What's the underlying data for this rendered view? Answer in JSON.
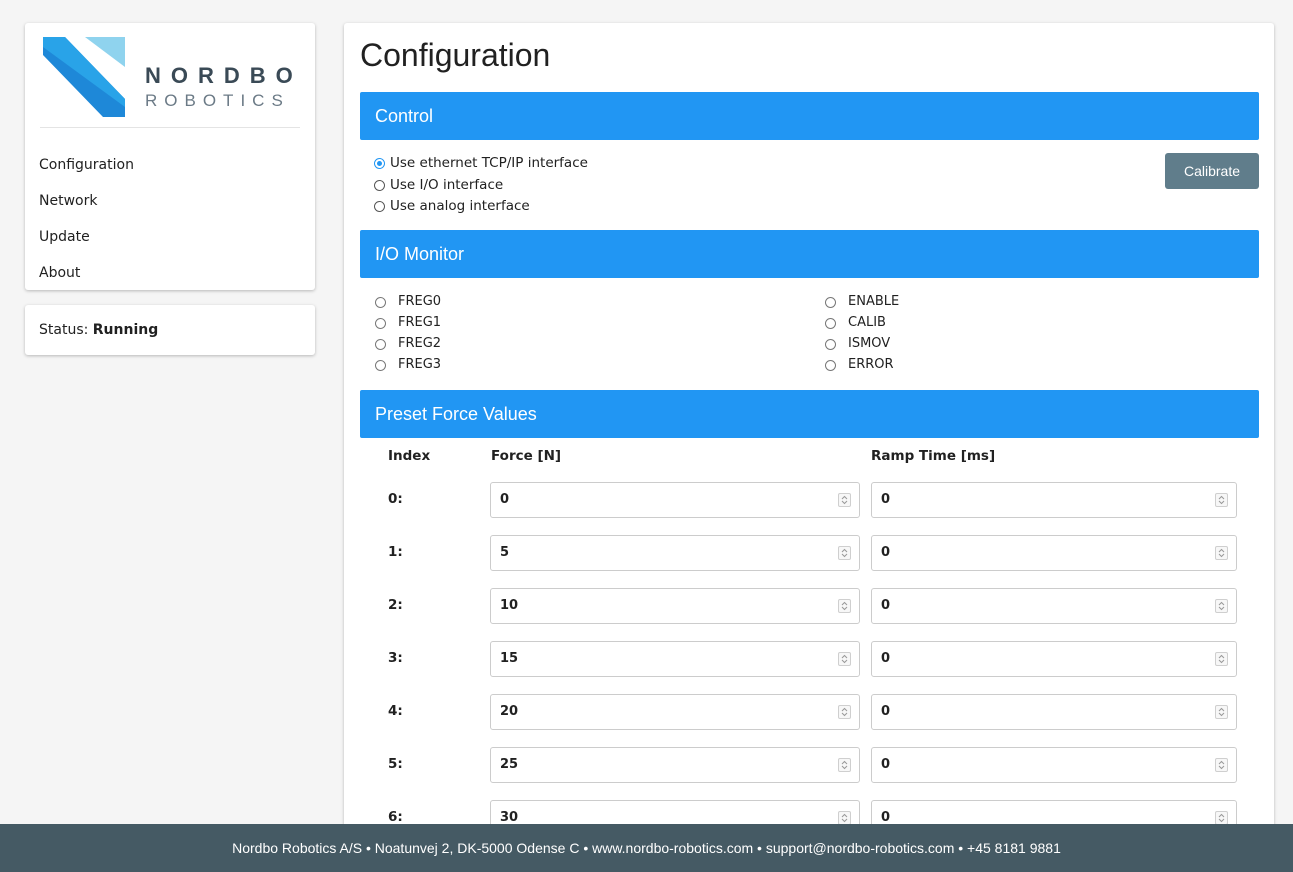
{
  "brand": {
    "name_line1": "NORDBO",
    "name_line2": "ROBOTICS",
    "colors": {
      "primary": "#2196f3",
      "light": "#8fd3ee",
      "footer": "#455a64",
      "button": "#607d8b"
    }
  },
  "sidebar": {
    "items": [
      {
        "label": "Configuration"
      },
      {
        "label": "Network"
      },
      {
        "label": "Update"
      },
      {
        "label": "About"
      }
    ],
    "status": {
      "label": "Status:",
      "value": "Running"
    }
  },
  "main": {
    "title": "Configuration",
    "control": {
      "header": "Control",
      "options": [
        {
          "label": "Use ethernet TCP/IP interface",
          "checked": true
        },
        {
          "label": "Use I/O interface",
          "checked": false
        },
        {
          "label": "Use analog interface",
          "checked": false
        }
      ],
      "calibrate_label": "Calibrate"
    },
    "io_monitor": {
      "header": "I/O Monitor",
      "left": [
        "FREG0",
        "FREG1",
        "FREG2",
        "FREG3"
      ],
      "right": [
        "ENABLE",
        "CALIB",
        "ISMOV",
        "ERROR"
      ]
    },
    "preset": {
      "header": "Preset Force Values",
      "columns": [
        "Index",
        "Force [N]",
        "Ramp Time [ms]"
      ],
      "rows": [
        {
          "index": "0:",
          "force": "0",
          "ramp": "0"
        },
        {
          "index": "1:",
          "force": "5",
          "ramp": "0"
        },
        {
          "index": "2:",
          "force": "10",
          "ramp": "0"
        },
        {
          "index": "3:",
          "force": "15",
          "ramp": "0"
        },
        {
          "index": "4:",
          "force": "20",
          "ramp": "0"
        },
        {
          "index": "5:",
          "force": "25",
          "ramp": "0"
        },
        {
          "index": "6:",
          "force": "30",
          "ramp": "0"
        }
      ]
    }
  },
  "footer": {
    "text": "Nordbo Robotics A/S • Noatunvej 2, DK-5000 Odense C • www.nordbo-robotics.com • support@nordbo-robotics.com • +45 8181 9881"
  }
}
